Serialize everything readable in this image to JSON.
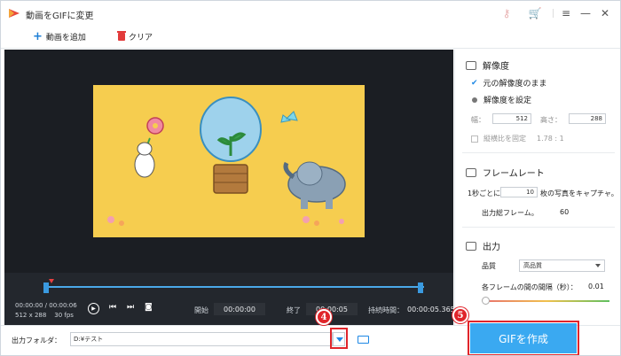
{
  "window": {
    "title": "動画をGIFに変更",
    "controls": {
      "minimize": "—",
      "maximize": "☐",
      "close": "✕"
    }
  },
  "toolbar": {
    "add_video_label": "動画を追加",
    "clear_label": "クリア"
  },
  "player": {
    "time_current": "00:00:00",
    "time_total": "00:00:06",
    "resolution": "512 x 288",
    "fps": "30 fps",
    "start_label": "開始",
    "start_value": "00:00:00",
    "end_label": "終了",
    "end_value": "00:00:05",
    "duration_label": "持続時間：",
    "duration_value": "00:00:05.365"
  },
  "resolution": {
    "title": "解像度",
    "option_keep": "元の解像度のまま",
    "option_set": "解像度を設定",
    "width_label": "幅：",
    "width_value": "512",
    "height_label": "高さ：",
    "height_value": "288",
    "aspect_label": "縦横比を固定",
    "aspect_value": "1.78 : 1"
  },
  "framerate": {
    "title": "フレームレート",
    "per_sec_label": "1秒ごとに",
    "per_sec_value": "10",
    "per_sec_suffix": "枚の写真をキャプチャ。",
    "total_label": "出力総フレーム。",
    "total_value": "60"
  },
  "output": {
    "title": "出力",
    "quality_label": "品質",
    "quality_value": "高品質",
    "interval_label": "各フレームの間の間隔（秒）：",
    "interval_value": "0.01"
  },
  "bottom": {
    "folder_label": "出力フォルダ：",
    "folder_value": "D:¥テスト",
    "create_gif_label": "GIFを作成",
    "badge_4": "4",
    "badge_5": "5"
  },
  "colors": {
    "accent": "#3aa9f1",
    "highlight": "#e0252b",
    "preview_bg": "#f6cd4f"
  }
}
